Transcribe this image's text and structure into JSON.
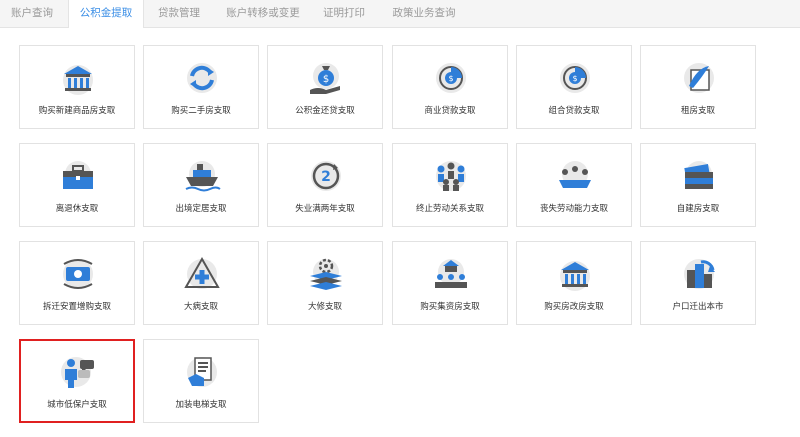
{
  "tabs": [
    {
      "label": "账户查询",
      "active": false
    },
    {
      "label": "公积金提取",
      "active": true
    },
    {
      "label": "贷款管理",
      "active": false
    },
    {
      "label": "账户转移或变更",
      "active": false
    },
    {
      "label": "证明打印",
      "active": false
    },
    {
      "label": "政策业务查询",
      "active": false
    }
  ],
  "tiles": [
    {
      "label": "购买新建商品房支取",
      "icon": "bank-building-icon"
    },
    {
      "label": "购买二手房支取",
      "icon": "refresh-arrows-icon"
    },
    {
      "label": "公积金还贷支取",
      "icon": "money-bag-hand-icon"
    },
    {
      "label": "商业贷款支取",
      "icon": "coin-chart-icon"
    },
    {
      "label": "组合贷款支取",
      "icon": "coin-chart-icon"
    },
    {
      "label": "租房支取",
      "icon": "quill-scroll-icon"
    },
    {
      "label": "离退休支取",
      "icon": "briefcase-icon"
    },
    {
      "label": "出境定居支取",
      "icon": "ship-icon"
    },
    {
      "label": "失业满两年支取",
      "icon": "number-two-cycle-icon"
    },
    {
      "label": "终止劳动关系支取",
      "icon": "people-group-icon"
    },
    {
      "label": "丧失劳动能力支取",
      "icon": "meeting-table-icon"
    },
    {
      "label": "自建房支取",
      "icon": "cash-stack-icon"
    },
    {
      "label": "拆迁安置增购支取",
      "icon": "cash-cycle-icon"
    },
    {
      "label": "大病支取",
      "icon": "medical-cross-icon"
    },
    {
      "label": "大修支取",
      "icon": "gear-layers-icon"
    },
    {
      "label": "购买集资房支取",
      "icon": "team-house-icon"
    },
    {
      "label": "购买房改房支取",
      "icon": "bank-building-icon"
    },
    {
      "label": "户口迁出本市",
      "icon": "city-arrow-icon"
    },
    {
      "label": "城市低保户支取",
      "icon": "person-chat-icon",
      "selected": true
    },
    {
      "label": "加装电梯支取",
      "icon": "hand-document-icon"
    }
  ],
  "colors": {
    "accent": "#3a8ee6",
    "selected_border": "#e02020",
    "icon_blue": "#2f7ed8"
  }
}
